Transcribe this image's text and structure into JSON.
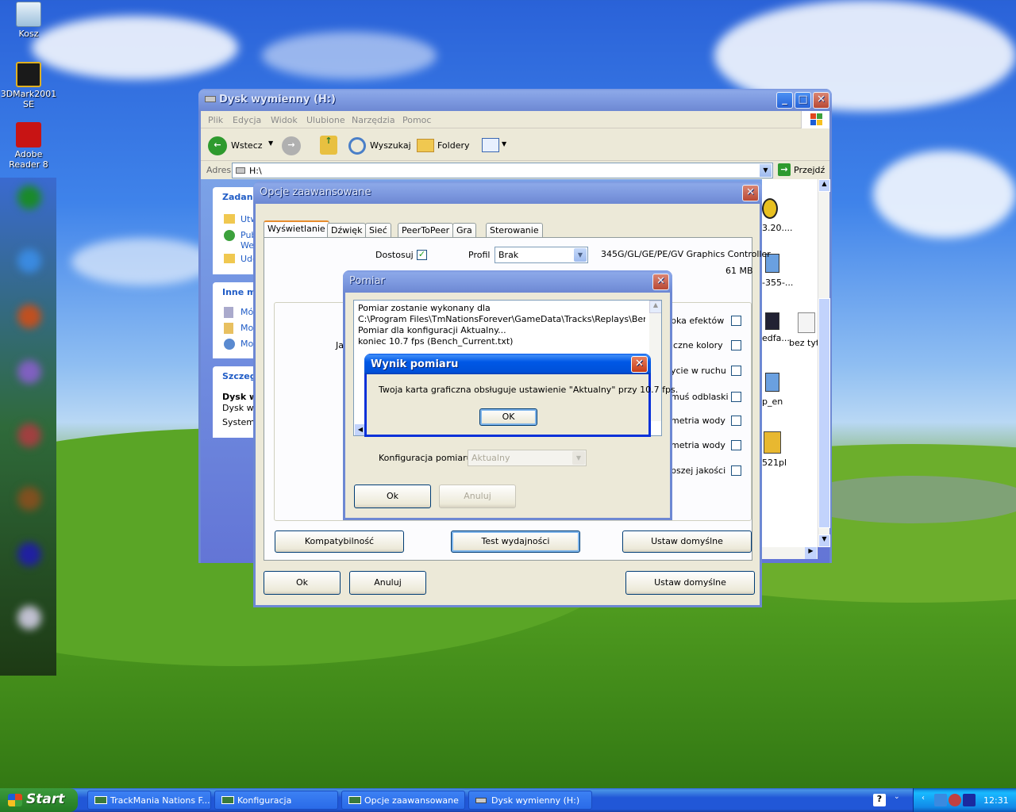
{
  "desktop": {
    "icons": [
      {
        "label": "Kosz"
      },
      {
        "label": "3DMark2001 SE"
      },
      {
        "label": "Adobe Reader 8"
      }
    ]
  },
  "explorer": {
    "title": "Dysk wymienny (H:)",
    "menu": [
      "Plik",
      "Edycja",
      "Widok",
      "Ulubione",
      "Narzędzia",
      "Pomoc"
    ],
    "toolbar": {
      "back": "Wstecz",
      "search": "Wyszukaj",
      "folders": "Foldery"
    },
    "address_label": "Adres",
    "address_value": "H:\\",
    "go_label": "Przejdź",
    "side_panels": [
      {
        "title": "Zadania",
        "items": [
          "Utw",
          "Pub",
          "Wel",
          "Udo"
        ]
      },
      {
        "title": "Inne m",
        "items": [
          "Mój",
          "Moj",
          "Moj"
        ]
      },
      {
        "title": "Szczeg",
        "items": [
          "Dysk w",
          "Dysk wy",
          "System p"
        ]
      }
    ],
    "files": [
      "3.20....",
      "-355-...",
      "edfa...",
      "bez tytu",
      "p_en",
      "521pl"
    ]
  },
  "advanced": {
    "title": "Opcje zaawansowane",
    "tabs": [
      "Wyświetlanie",
      "Dźwięk",
      "Sieć",
      "PeerToPeer",
      "Gra",
      "Sterowanie"
    ],
    "customize_label": "Dostosuj",
    "profile_label": "Profil",
    "profile_value": "Brak",
    "gpu": "345G/GL/GE/PE/GV Graphics Controller",
    "vram": "61 MB",
    "partial_label": "Jal",
    "options": [
      "bka efektów",
      "iczne kolory",
      "ycie w ruchu",
      "muś odblaski",
      "metria wody",
      "metria wody",
      "pszej jakości"
    ],
    "compat_button": "Kompatybilność",
    "perf_button": "Test wydajności",
    "defaults_button": "Ustaw domyślne",
    "ok": "Ok",
    "cancel": "Anuluj",
    "defaults_button2": "Ustaw domyślne"
  },
  "measure": {
    "title": "Pomiar",
    "log": [
      "Pomiar zostanie wykonany dla",
      "C:\\Program Files\\TmNationsForever\\GameData\\Tracks\\Replays\\Bench.Repla",
      "Pomiar dla konfiguracji Aktualny...",
      "koniec 10.7 fps (Bench_Current.txt)"
    ],
    "config_label": "Konfiguracja pomiaru",
    "config_value": "Aktualny",
    "ok": "Ok",
    "cancel": "Anuluj"
  },
  "result": {
    "title": "Wynik pomiaru",
    "message": "Twoja karta graficzna obsługuje ustawienie \"Aktualny\" przy 10.7 fps.",
    "ok": "OK"
  },
  "taskbar": {
    "start": "Start",
    "tasks": [
      "TrackMania Nations F...",
      "Konfiguracja",
      "Opcje zaawansowane",
      "Dysk wymienny (H:)"
    ],
    "clock": "12:31"
  }
}
